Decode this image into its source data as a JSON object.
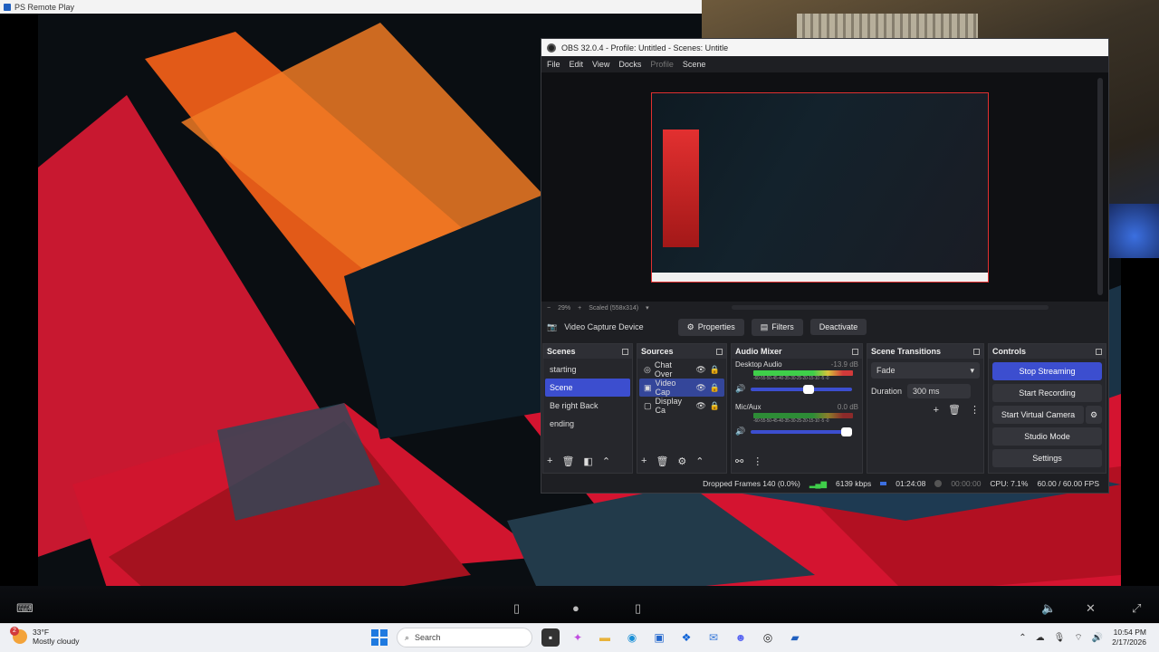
{
  "remote_play": {
    "title": "PS Remote Play"
  },
  "obs": {
    "title": "OBS 32.0.4 - Profile: Untitled - Scenes: Untitle",
    "menu": [
      "File",
      "Edit",
      "View",
      "Docks",
      "Profile",
      "Scene"
    ],
    "zoom": {
      "minus": "−",
      "percent": "29%",
      "plus": "+",
      "scaled": "Scaled (558x314)"
    },
    "source_bar": {
      "name": "Video Capture Device",
      "properties": "Properties",
      "filters": "Filters",
      "deactivate": "Deactivate"
    },
    "scenes": {
      "title": "Scenes",
      "items": [
        "starting",
        "Scene",
        "Be right Back",
        "ending"
      ],
      "selected": 1
    },
    "sources": {
      "title": "Sources",
      "items": [
        "Chat Over",
        "Video Cap",
        "Display Ca"
      ],
      "selected": 1
    },
    "mixer": {
      "title": "Audio Mixer",
      "ticks": "-60-55-50-45-40-35-30-25-20-15-10 -5 -0",
      "channels": [
        {
          "name": "Desktop Audio",
          "db": "-13.9 dB",
          "level": 0.78
        },
        {
          "name": "Mic/Aux",
          "db": "0.0 dB",
          "level": 1.0
        }
      ]
    },
    "transitions": {
      "title": "Scene Transitions",
      "type": "Fade",
      "duration_label": "Duration",
      "duration": "300 ms"
    },
    "controls": {
      "title": "Controls",
      "stop_streaming": "Stop Streaming",
      "start_recording": "Start Recording",
      "start_virtual_camera": "Start Virtual Camera",
      "studio_mode": "Studio Mode",
      "settings": "Settings"
    },
    "status": {
      "dropped": "Dropped Frames 140 (0.0%)",
      "bitrate": "6139 kbps",
      "stream_time": "01:24:08",
      "rec_time": "00:00:00",
      "cpu": "CPU: 7.1%",
      "fps": "60.00 / 60.00 FPS"
    }
  },
  "taskbar": {
    "weather": {
      "temp": "33°F",
      "desc": "Mostly cloudy",
      "badge": "2"
    },
    "search": "Search",
    "time": "10:54 PM",
    "date": "2/17/2026"
  }
}
